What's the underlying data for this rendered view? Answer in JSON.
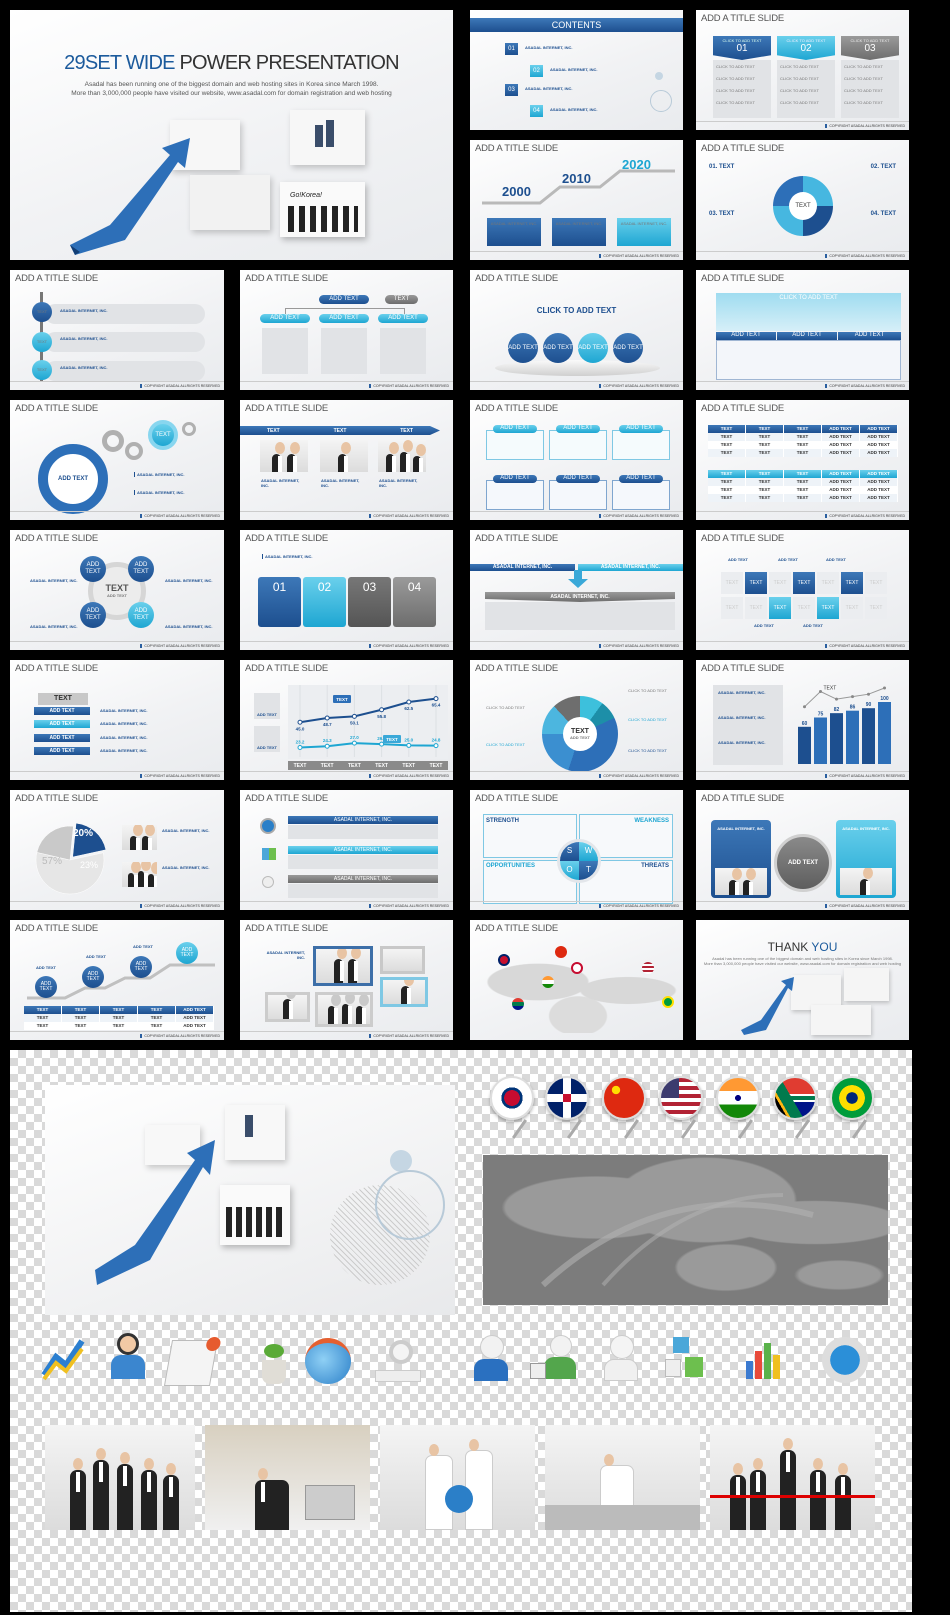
{
  "watermark": "asadal .com",
  "common": {
    "slide_title": "ADD A TITLE SLIDE",
    "copyright": "COPYRIGHT ASADAL ALLRIGHTS RESERVED",
    "company": "ASADAL INTERNET, INC.",
    "click": "CLICK TO ADD TEXT",
    "click_short": "Click to add text",
    "add": "ADD TEXT",
    "text": "TEXT",
    "body": "started its business in Seoul Korea in February 1998 with the fundamental goal of providing better internet services to the world."
  },
  "cover": {
    "title_accent": "29SET WIDE",
    "title_rest": " POWER PRESENTATION",
    "line1": "Asadal has been running one of the biggest domain and web hosting sites in Korea since March 1998.",
    "line2": "More than 3,000,000 people have visited our website, www.asadal.com for domain registration and web hosting",
    "banner": "Go!Korea!"
  },
  "contents": {
    "title": "CONTENTS",
    "items": [
      "01",
      "02",
      "03",
      "04"
    ]
  },
  "three_col": {
    "headers": [
      "01",
      "02",
      "03"
    ]
  },
  "timeline": {
    "years": [
      "2000",
      "2010",
      "2020"
    ]
  },
  "quad": {
    "labels": [
      "01. TEXT",
      "02. TEXT",
      "03. TEXT",
      "04. TEXT"
    ]
  },
  "cards": {
    "numbers": [
      "01",
      "02",
      "03",
      "04"
    ]
  },
  "swot": {
    "strength": "STRENGTH",
    "weakness": "WEAKNESS",
    "opportunities": "OPPORTUNITIES",
    "threats": "THREATS",
    "letters": [
      "S",
      "W",
      "O",
      "T"
    ]
  },
  "thank_you": {
    "thank": "THANK",
    "you": "YOU"
  },
  "colors": {
    "primary": "#1d4f8f",
    "accent": "#1ea6d2",
    "neutral": "#7a7a7a"
  },
  "flags": [
    "south-korea",
    "united-kingdom",
    "china",
    "united-states",
    "india",
    "south-africa",
    "brazil"
  ],
  "chart_data": [
    {
      "type": "line",
      "categories": [
        "TEXT",
        "TEXT",
        "TEXT",
        "TEXT",
        "TEXT",
        "TEXT"
      ],
      "series": [
        {
          "values": [
            45.0,
            48.7,
            50.1,
            55.8,
            62.5,
            65.4
          ],
          "color": "#1d4f8f"
        },
        {
          "values": [
            23.2,
            24.3,
            27.0,
            26.1,
            25.0,
            24.8
          ],
          "color": "#1ea6d2"
        }
      ],
      "callouts": [
        "TEXT",
        "TEXT"
      ],
      "legend_labels": [
        "ADD TEXT",
        "ADD TEXT"
      ]
    },
    {
      "type": "bar",
      "values": [
        60,
        75,
        82,
        86,
        90,
        100
      ],
      "annotation": "TEXT"
    },
    {
      "type": "pie",
      "values": [
        20,
        57,
        23
      ],
      "labels": [
        "20%",
        "57%",
        "23%"
      ],
      "slice_label": "ADD TEXT"
    }
  ]
}
